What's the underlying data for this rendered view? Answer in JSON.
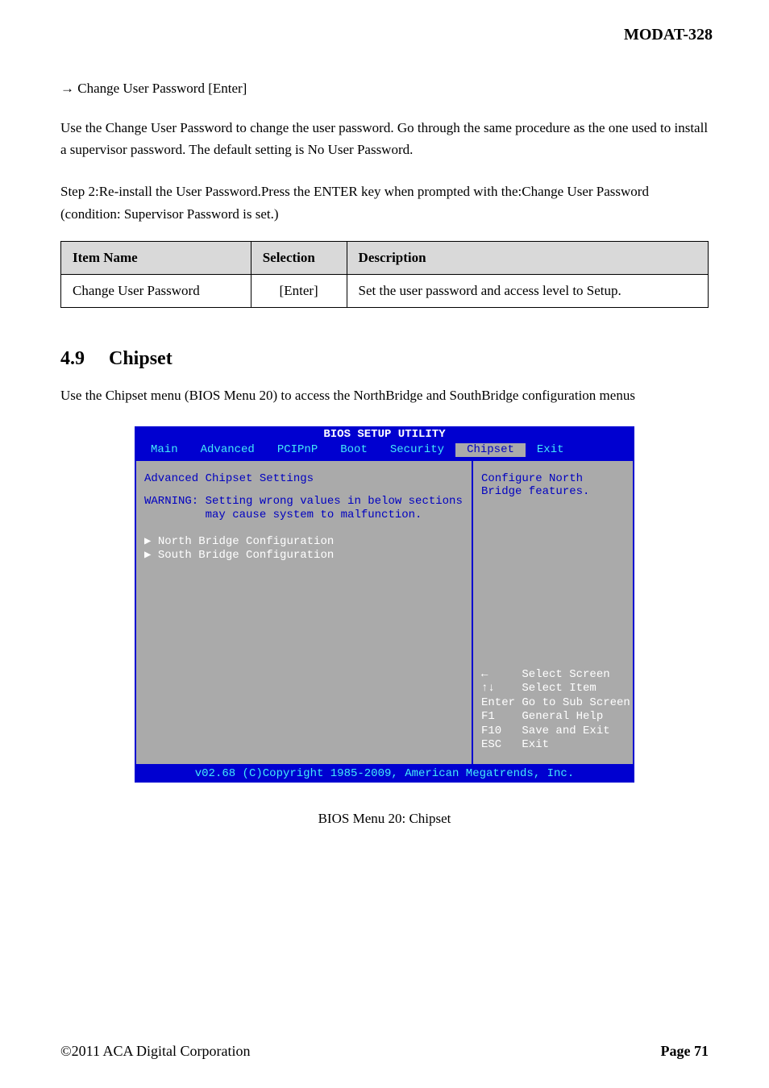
{
  "page_header": "MODAT-328",
  "section1": {
    "label": "→ Change User Password [Enter]",
    "desc": "Use the Change User Password to change the user password. Go through the same procedure as the one used to install a supervisor password. The default setting is No User Password.",
    "step": "Step 2:Re-install the User Password.Press the ENTER key when prompted with the:Change User Password (condition: Supervisor Password is set.)"
  },
  "table": {
    "headers": [
      "Item Name",
      "Selection",
      "Description"
    ],
    "row": {
      "item": "Change User Password",
      "selection": "[Enter]",
      "description": "Set the user password and access level to Setup."
    }
  },
  "heading": {
    "num": "4.9",
    "text": "Chipset"
  },
  "heading_desc": "Use the Chipset menu (BIOS Menu 20) to access the NorthBridge and SouthBridge configuration menus",
  "bios": {
    "title": "BIOS SETUP UTILITY",
    "tabs": [
      "Main",
      "Advanced",
      "PCIPnP",
      "Boot",
      "Security",
      "Chipset",
      "Exit"
    ],
    "left_title": "Advanced Chipset Settings",
    "warning_line1": "WARNING: Setting wrong values in below sections",
    "warning_line2": "         may cause system to malfunction.",
    "submenu1": "▶ North Bridge Configuration",
    "submenu2": "▶ South Bridge Configuration",
    "help": "Configure North Bridge features.",
    "hints_l1": "←     Select Screen",
    "hints_l2": "↑↓    Select Item",
    "hints_l3": "Enter Go to Sub Screen",
    "hints_l4": "F1    General Help",
    "hints_l5": "F10   Save and Exit",
    "hints_l6": "ESC   Exit",
    "footer": "v02.68 (C)Copyright 1985-2009, American Megatrends, Inc."
  },
  "figure_label": "BIOS Menu 20: Chipset",
  "footer_left": "©2011 ACA Digital Corporation",
  "footer_right": "Page 71"
}
